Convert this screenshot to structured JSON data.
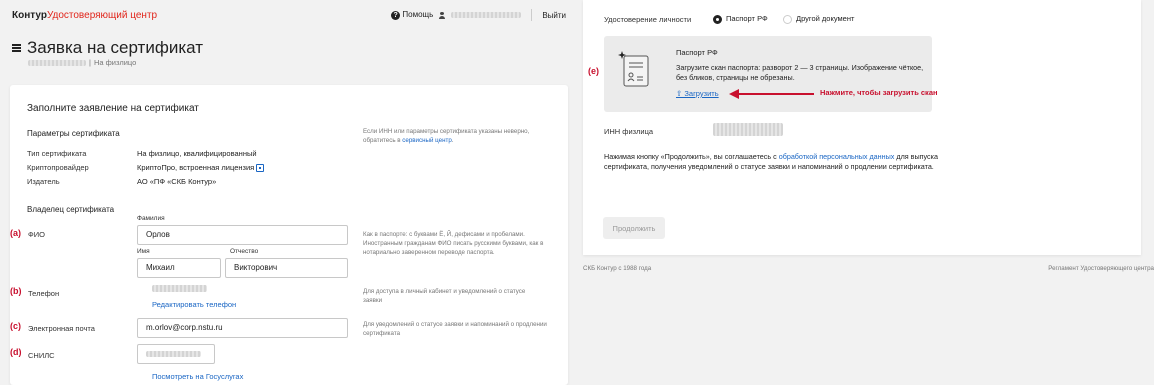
{
  "header": {
    "logo_main": "Контур",
    "logo_sub": "Удостоверяющий центр",
    "help": "Помощь",
    "logout": "Выйти"
  },
  "page": {
    "title": "Заявка на сертификат",
    "subtitle": "На физлицо"
  },
  "form": {
    "title": "Заполните заявление на сертификат",
    "params": {
      "section": "Параметры сертификата",
      "hint_prefix": "Если ИНН или параметры сертификата указаны неверно, обратитесь в",
      "hint_link": "сервисный центр",
      "rows": [
        {
          "label": "Тип сертификата",
          "value": "На физлицо, квалифицированный"
        },
        {
          "label": "Криптопровайдер",
          "value": "КриптоПро, встроенная лицензия"
        },
        {
          "label": "Издатель",
          "value": "АО «ПФ «СКБ Контур»"
        }
      ]
    },
    "owner": {
      "section": "Владелец сертификата",
      "fio": {
        "annot": "(a)",
        "label": "ФИО",
        "surname_label": "Фамилия",
        "surname": "Орлов",
        "name_label": "Имя",
        "name": "Михаил",
        "patronymic_label": "Отчество",
        "patronymic": "Викторович",
        "hint": "Как в паспорте: с буквами Ё, Й, дефисами и пробелами. Иностранным гражданам ФИО писать русскими буквами, как в нотариально заверенном переводе паспорта."
      },
      "phone": {
        "annot": "(b)",
        "label": "Телефон",
        "edit_link": "Редактировать телефон",
        "hint": "Для доступа в личный кабинет и уведомлений о статусе заявки"
      },
      "email": {
        "annot": "(c)",
        "label": "Электронная почта",
        "value": "m.orlov@corp.nstu.ru",
        "hint": "Для уведомлений о статусе заявки и напоминаний о продлении сертификата"
      },
      "snils": {
        "annot": "(d)",
        "label": "СНИЛС",
        "link": "Посмотреть на Госуслугах"
      }
    }
  },
  "identity": {
    "label": "Удостоверение личности",
    "options": [
      "Паспорт РФ",
      "Другой документ"
    ],
    "selected": 0,
    "upload": {
      "annot": "(e)",
      "title": "Паспорт РФ",
      "text": "Загрузите скан паспорта: разворот 2 — 3 страницы. Изображение чёткое, без бликов, страницы не обрезаны.",
      "link": "⇧ Загрузить",
      "note": "Нажмите, чтобы загрузить скан"
    },
    "inn_label": "ИНН физлица",
    "agree_prefix": "Нажимая кнопку «Продолжить», вы соглашаетесь с",
    "agree_link": "обработкой персональных данных",
    "agree_suffix": "для выпуска сертификата, получения уведомлений о статусе заявки и напоминаний о продлении сертификата.",
    "continue": "Продолжить"
  },
  "footer": {
    "left": "СКБ Контур с 1988 года",
    "right": "Регламент Удостоверяющего центра"
  },
  "colors": {
    "brand_red": "#e1251b",
    "link_blue": "#1a66c4",
    "annotation_red": "#c8102e"
  }
}
